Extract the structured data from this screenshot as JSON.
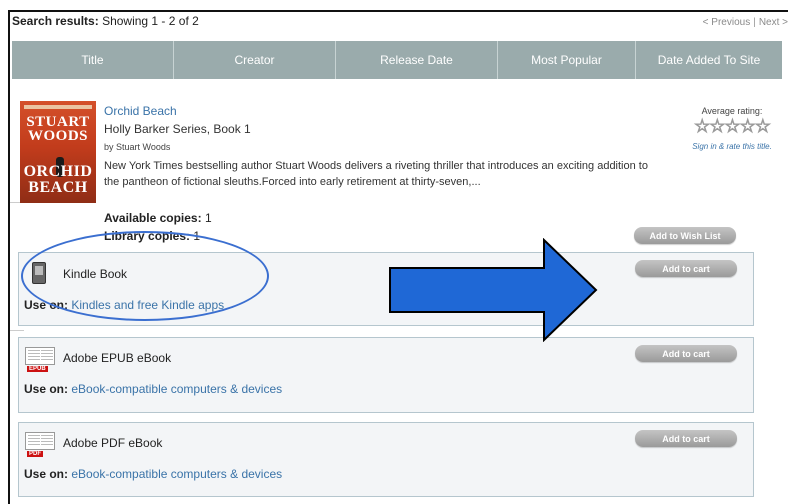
{
  "results": {
    "label": "Search results:",
    "text": "Showing 1 - 2 of 2"
  },
  "pager": {
    "prev": "< Previous",
    "sep": "|",
    "next": "Next >"
  },
  "sort_columns": [
    "Title",
    "Creator",
    "Release Date",
    "Most Popular",
    "Date Added To Site"
  ],
  "book": {
    "cover": {
      "author_line1": "STUART",
      "author_line2": "WOODS",
      "title_line1": "ORCHID",
      "title_line2": "BEACH"
    },
    "title": "Orchid Beach",
    "series": "Holly Barker Series, Book 1",
    "byline": "by Stuart Woods",
    "description": "New York Times bestselling author Stuart Woods delivers a riveting thriller that introduces an exciting addition to the pantheon of fictional sleuths.Forced into early retirement at thirty-seven,...",
    "rating_label": "Average rating:",
    "stars": "☆☆☆☆☆",
    "rate_link": "Sign in & rate this title.",
    "available_label": "Available copies:",
    "available_value": "1",
    "library_label": "Library copies:",
    "library_value": "1",
    "wish_button": "Add to Wish List"
  },
  "formats": [
    {
      "name": "Kindle Book",
      "use_label": "Use on:",
      "use_value": "Kindles and free Kindle apps",
      "button": "Add to cart",
      "icon": "kindle-device-icon"
    },
    {
      "name": "Adobe EPUB eBook",
      "use_label": "Use on:",
      "use_value": "eBook-compatible computers & devices",
      "button": "Add to cart",
      "icon": "epub-book-icon",
      "icon_tag": "EPUB"
    },
    {
      "name": "Adobe PDF eBook",
      "use_label": "Use on:",
      "use_value": "eBook-compatible computers & devices",
      "button": "Add to cart",
      "icon": "pdf-book-icon",
      "icon_tag": "PDF"
    }
  ],
  "annotation": {
    "ellipse_color": "#3b6fd0",
    "arrow_fill": "#1f68d6",
    "arrow_stroke": "#000000"
  },
  "colors": {
    "header_bar": "#9aabac",
    "link": "#3a73a8",
    "format_box_border": "#b5c6ce"
  }
}
